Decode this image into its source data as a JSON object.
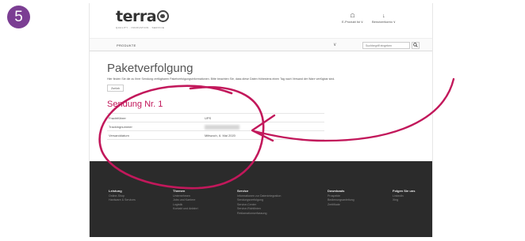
{
  "step_badge": "5",
  "annotation_color": "#c2185b",
  "header": {
    "logo_text": "terra",
    "logo_icon": "globe-icon",
    "tagline": "QUALITY · INNOVATION · SERVICE",
    "links": [
      {
        "icon": "user-icon",
        "label": "E-Produkt lst ∨"
      },
      {
        "icon": "download-icon",
        "label": "Benutzerkonto ∨"
      }
    ]
  },
  "nav": {
    "products_label": "PRODUKTE",
    "chevron": "∨",
    "search_placeholder": "Suchbegriff eingeben",
    "search_icon": "search-icon"
  },
  "content": {
    "title": "Paketverfolgung",
    "description": "Hier finden Sie die zu Ihrer Sendung verfügbaren Paketverfolgungsinformationen. Bitte beachten Sie, dass diese Daten frühestens einen Tag nach Versand der Ware verfügbar sind.",
    "back_label": "Zurück",
    "shipment_title": "Sendung Nr. 1",
    "rows": [
      {
        "label": "Frachtführer",
        "value": "UPS"
      },
      {
        "label": "Trackingnummer",
        "value": ""
      },
      {
        "label": "Versanddatum",
        "value": "Mittwoch, 6. Mai 2020"
      }
    ]
  },
  "footer": {
    "columns": [
      {
        "heading": "Leistung",
        "items": [
          "Online-Shop",
          "Hardware & Services"
        ]
      },
      {
        "heading": "Themen",
        "items": [
          "Unternehmen",
          "Jobs und Karriere",
          "Logistik",
          "Kontakt und Anfahrt"
        ]
      },
      {
        "heading": "Service",
        "items": [
          "Informationen zur Datenintegration",
          "Sendungsverfolgung",
          "Service-Center",
          "Service-Richtlinien",
          "Reklamationserfassung"
        ]
      },
      {
        "heading": "Downloads",
        "items": [
          "Prospekte",
          "Bedienungsanleitung",
          "Zertifikate"
        ]
      },
      {
        "heading": "Folgen Sie uns",
        "items": [
          "LinkedIn",
          "Xing"
        ]
      }
    ]
  }
}
